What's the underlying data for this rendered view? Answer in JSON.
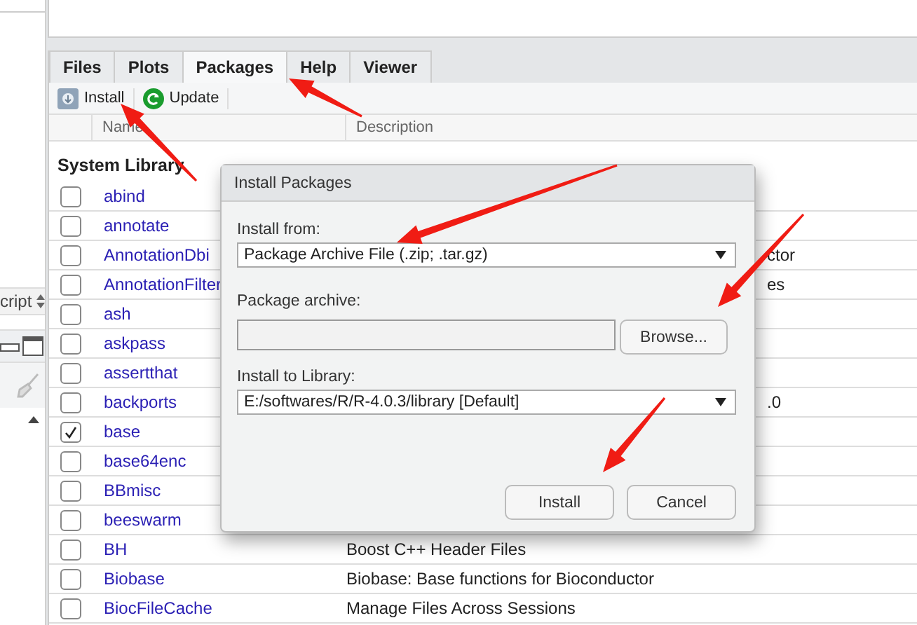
{
  "left_pane": {
    "source_menu": "cript"
  },
  "tabs": [
    {
      "label": "Files",
      "selected": false
    },
    {
      "label": "Plots",
      "selected": false
    },
    {
      "label": "Packages",
      "selected": true
    },
    {
      "label": "Help",
      "selected": false
    },
    {
      "label": "Viewer",
      "selected": false
    }
  ],
  "toolbar": [
    {
      "label": "Install",
      "kind": "install"
    },
    {
      "label": "Update",
      "kind": "update"
    }
  ],
  "table": {
    "columns": [
      "Name",
      "Description"
    ],
    "section": "System Library",
    "rows": [
      {
        "name": "abind",
        "checked": false
      },
      {
        "name": "annotate",
        "checked": false
      },
      {
        "name": "AnnotationDbi",
        "checked": false,
        "description": "ctor",
        "covered": true
      },
      {
        "name": "AnnotationFilter",
        "checked": false,
        "description": "es",
        "covered": true
      },
      {
        "name": "ash",
        "checked": false
      },
      {
        "name": "askpass",
        "checked": false
      },
      {
        "name": "assertthat",
        "checked": false
      },
      {
        "name": "backports",
        "checked": false,
        "description": ".0",
        "covered": true
      },
      {
        "name": "base",
        "checked": true
      },
      {
        "name": "base64enc",
        "checked": false
      },
      {
        "name": "BBmisc",
        "checked": false
      },
      {
        "name": "beeswarm",
        "checked": false
      },
      {
        "name": "BH",
        "checked": false,
        "description": "Boost C++ Header Files",
        "covered": false
      },
      {
        "name": "Biobase",
        "checked": false,
        "description": "Biobase: Base functions for Bioconductor",
        "covered": false
      },
      {
        "name": "BiocFileCache",
        "checked": false,
        "description": "Manage Files Across Sessions",
        "covered": false
      }
    ]
  },
  "dialog": {
    "title": "Install Packages",
    "install_from_label": "Install from:",
    "install_from_value": "Package Archive File (.zip; .tar.gz)",
    "archive_label": "Package archive:",
    "browse_button": "Browse...",
    "library_label": "Install to Library:",
    "library_value": "E:/softwares/R/R-4.0.3/library [Default]",
    "buttons": [
      "Install",
      "Cancel"
    ]
  }
}
